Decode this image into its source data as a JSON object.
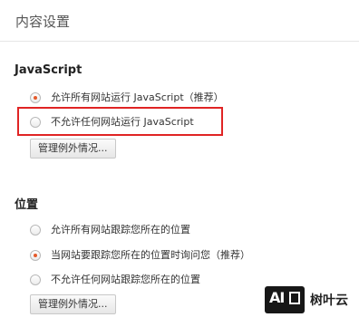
{
  "page": {
    "title": "内容设置"
  },
  "javascript": {
    "heading": "JavaScript",
    "options": [
      {
        "label": "允许所有网站运行 JavaScript（推荐）",
        "checked": true
      },
      {
        "label": "不允许任何网站运行 JavaScript",
        "checked": false
      }
    ],
    "manage_label": "管理例外情况..."
  },
  "location": {
    "heading": "位置",
    "options": [
      {
        "label": "允许所有网站跟踪您所在的位置",
        "checked": false
      },
      {
        "label": "当网站要跟踪您所在的位置时询问您（推荐）",
        "checked": true
      },
      {
        "label": "不允许任何网站跟踪您所在的位置",
        "checked": false
      }
    ],
    "manage_label": "管理例外情况..."
  },
  "annotation": {
    "highlight_color": "#e02424"
  },
  "watermark": {
    "logo_text": "AI",
    "text": "树叶云"
  },
  "colors": {
    "radio_selected": "#e55a2b",
    "heading": "#222222",
    "text": "#333333"
  }
}
